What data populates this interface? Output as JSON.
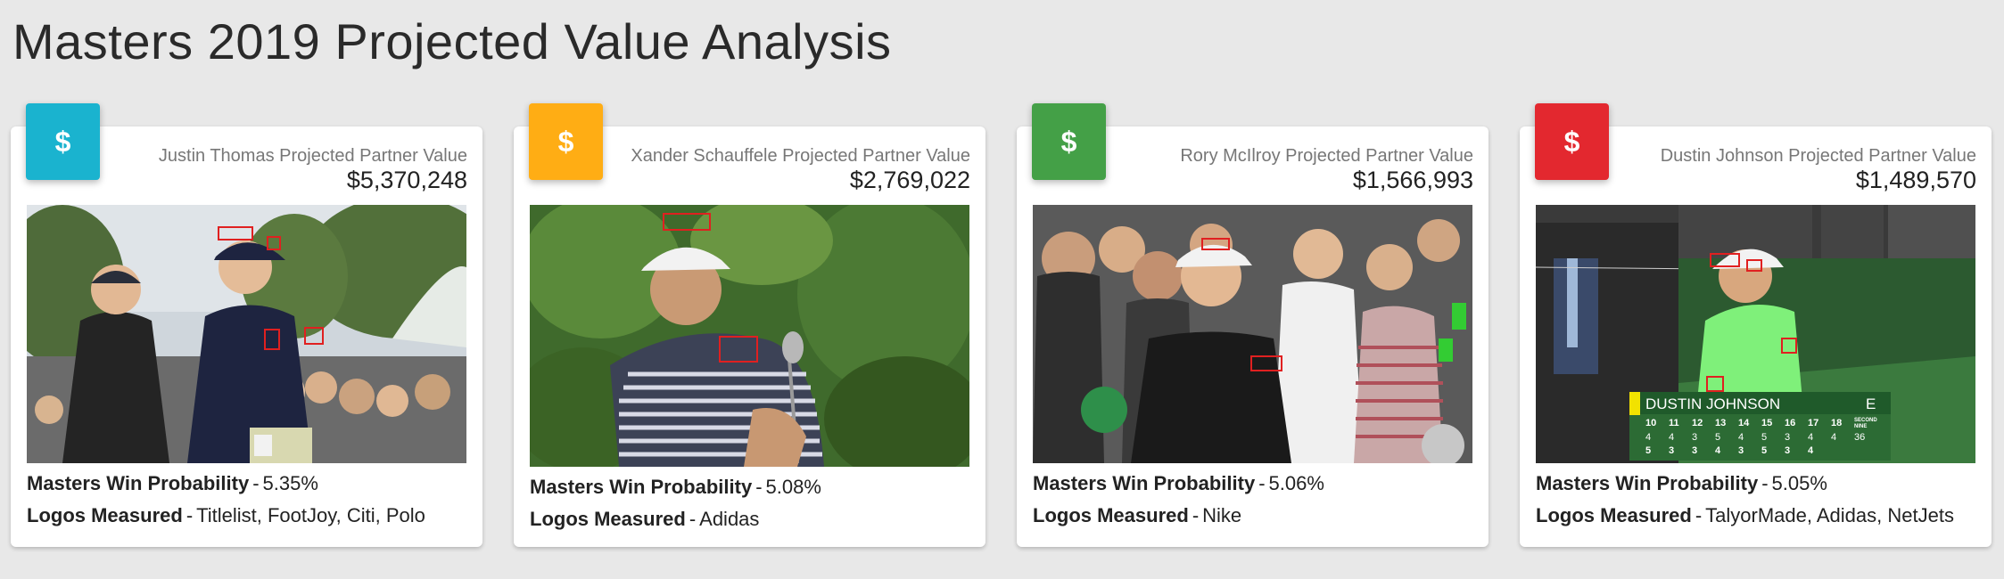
{
  "page": {
    "title": "Masters 2019 Projected Value Analysis"
  },
  "stat_labels": {
    "win_probability": "Masters Win Probability",
    "logos": "Logos Measured"
  },
  "cards": [
    {
      "badge_icon": "dollar-icon",
      "badge_glyph": "$",
      "badge_color": "#1ab3cf",
      "value_label": "Justin Thomas Projected Partner Value",
      "value_amount": "$5,370,248",
      "win_probability": "5.35%",
      "logos": "Titlelist, FootJoy, Citi, Polo"
    },
    {
      "badge_icon": "dollar-icon",
      "badge_glyph": "$",
      "badge_color": "#ffad14",
      "value_label": "Xander Schauffele Projected Partner Value",
      "value_amount": "$2,769,022",
      "win_probability": "5.08%",
      "logos": "Adidas"
    },
    {
      "badge_icon": "dollar-icon",
      "badge_glyph": "$",
      "badge_color": "#44a047",
      "value_label": "Rory McIlroy Projected Partner Value",
      "value_amount": "$1,566,993",
      "win_probability": "5.06%",
      "logos": "Nike"
    },
    {
      "badge_icon": "dollar-icon",
      "badge_glyph": "$",
      "badge_color": "#e3282f",
      "value_label": "Dustin Johnson Projected Partner Value",
      "value_amount": "$1,489,570",
      "win_probability": "5.05%",
      "logos": "TalyorMade, Adidas, NetJets"
    }
  ],
  "scoreboard": {
    "player_name": "DUSTIN JOHNSON",
    "score": "E",
    "holes": [
      "10",
      "11",
      "12",
      "13",
      "14",
      "15",
      "16",
      "17",
      "18"
    ],
    "second_nine_label": "SECOND NINE",
    "par_row": [
      "4",
      "4",
      "3",
      "5",
      "4",
      "5",
      "3",
      "4",
      "4",
      "36"
    ],
    "score_row": [
      "5",
      "3",
      "3",
      "4",
      "3",
      "5",
      "3",
      "4"
    ]
  },
  "colors": {
    "logo_box": "#e02020",
    "page_background": "#e8e8e8"
  }
}
